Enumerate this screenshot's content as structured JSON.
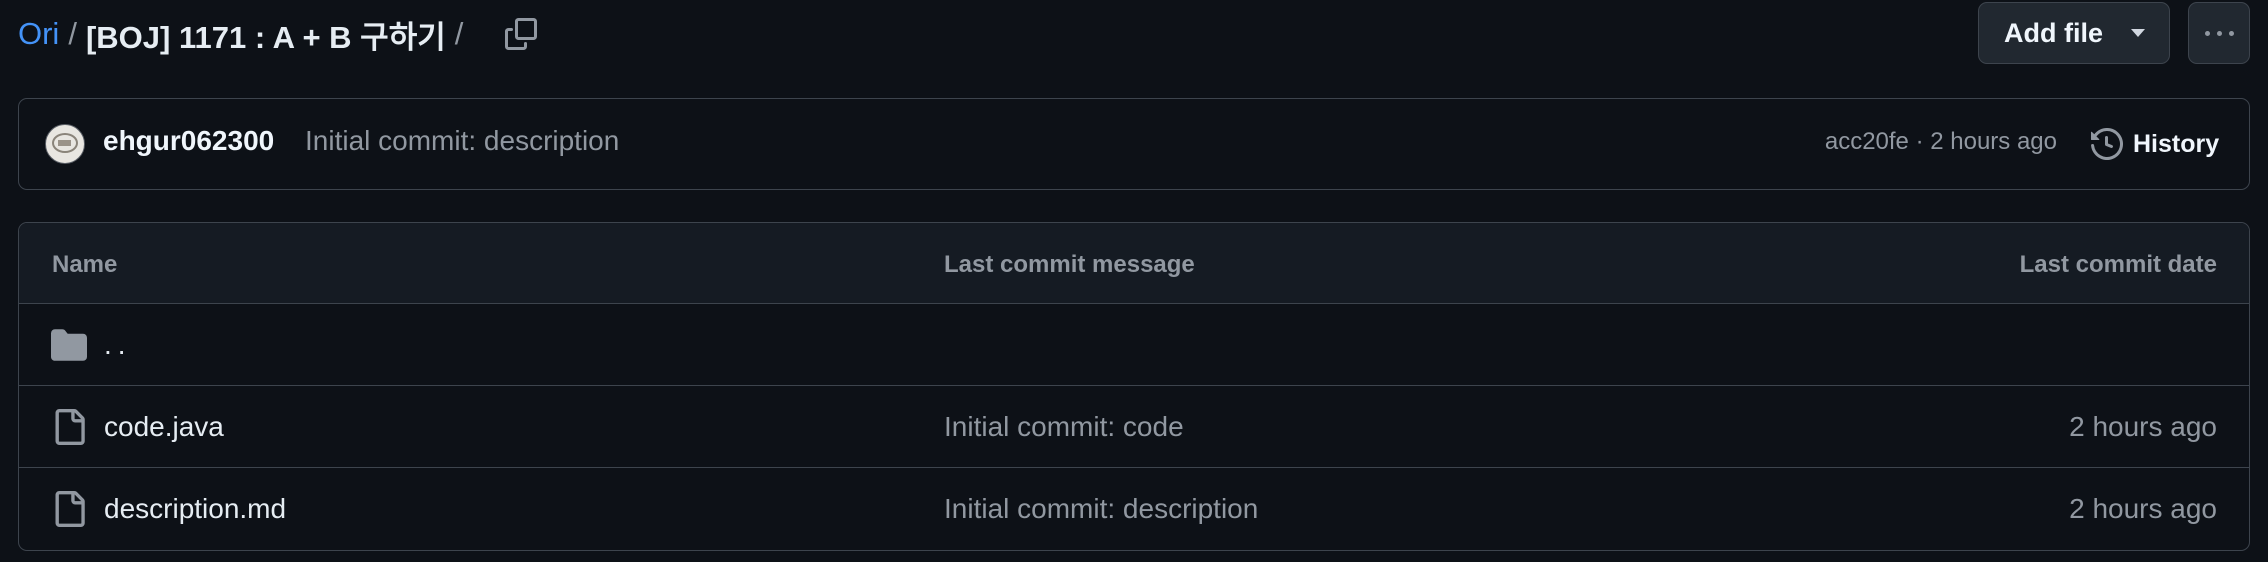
{
  "breadcrumb": {
    "repo": "Ori",
    "separator": "/",
    "current": "[BOJ] 1171 : A + B 구하기",
    "trailing_separator": "/"
  },
  "actions": {
    "add_file_label": "Add file"
  },
  "latest_commit": {
    "author": "ehgur062300",
    "message": "Initial commit: description",
    "meta": "acc20fe · 2 hours ago",
    "history_label": "History"
  },
  "table": {
    "headers": {
      "name": "Name",
      "message": "Last commit message",
      "date": "Last commit date"
    },
    "parent": "..",
    "rows": [
      {
        "name": "code.java",
        "message": "Initial commit: code",
        "date": "2 hours ago"
      },
      {
        "name": "description.md",
        "message": "Initial commit: description",
        "date": "2 hours ago"
      }
    ]
  },
  "icons": {
    "copy": "copy-icon",
    "more": "kebab-horizontal-icon",
    "history": "history-icon",
    "folder": "folder-icon",
    "file": "file-icon"
  },
  "colors": {
    "background": "#0d1117",
    "link": "#4493f8",
    "border": "#3d444d",
    "muted_text": "#9198a1"
  }
}
